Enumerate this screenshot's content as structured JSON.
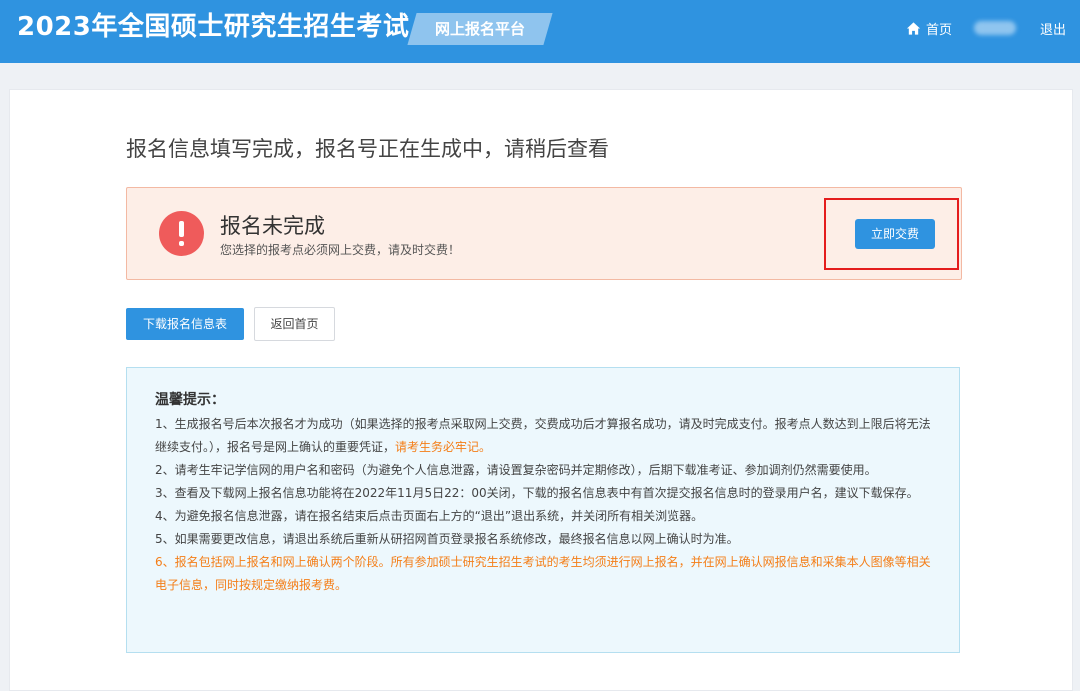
{
  "header": {
    "title": "2023年全国硕士研究生招生考试",
    "platform": "网上报名平台",
    "home": "首页",
    "logout": "退出"
  },
  "main": {
    "title": "报名信息填写完成，报名号正在生成中，请稍后查看",
    "alert": {
      "title": "报名未完成",
      "subtitle": "您选择的报考点必须网上交费，请及时交费！",
      "pay_button": "立即交费"
    },
    "download_button": "下载报名信息表",
    "back_button": "返回首页"
  },
  "tips": {
    "title": "温馨提示：",
    "item1": "1、生成报名号后本次报名才为成功（如果选择的报考点采取网上交费，交费成功后才算报名成功，请及时完成支付。报考点人数达到上限后将无法继续支付。），报名号是网上确认的重要凭证，",
    "item1_highlight": "请考生务必牢记。",
    "item2": "2、请考生牢记学信网的用户名和密码（为避免个人信息泄露，请设置复杂密码并定期修改），后期下载准考证、参加调剂仍然需要使用。",
    "item3": "3、查看及下载网上报名信息功能将在2022年11月5日22：00关闭，下载的报名信息表中有首次提交报名信息时的登录用户名，建议下载保存。",
    "item4": "4、为避免报名信息泄露，请在报名结束后点击页面右上方的“退出”退出系统，并关闭所有相关浏览器。",
    "item5": "5、如果需要更改信息，请退出系统后重新从研招网首页登录报名系统修改，最终报名信息以网上确认时为准。",
    "item6": "6、报名包括网上报名和网上确认两个阶段。所有参加硕士研究生招生考试的考生均须进行网上报名，并在网上确认网报信息和采集本人图像等相关电子信息，同时按规定缴纳报考费。"
  },
  "colors": {
    "primary": "#2f93e0",
    "alert_bg": "#fdeee7",
    "error_icon": "#ef5b5b",
    "highlight_border": "#e41d1d",
    "tips_bg": "#edf8fd",
    "orange_text": "#f47e18"
  },
  "icons": {
    "home": "home-icon",
    "alert": "exclamation-circle-icon"
  }
}
